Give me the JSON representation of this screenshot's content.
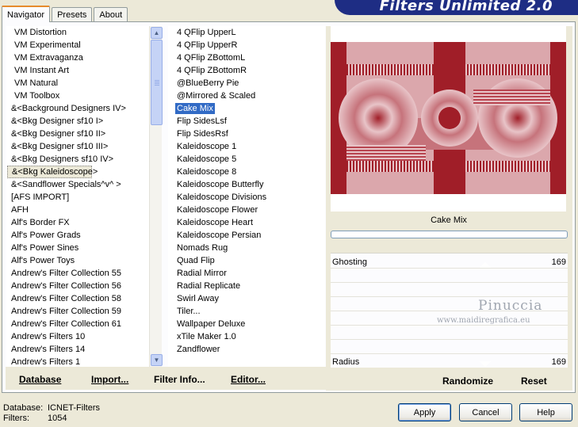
{
  "tabs": [
    "Navigator",
    "Presets",
    "About"
  ],
  "brand": "Filters Unlimited 2.0",
  "categories": [
    "VM Distortion",
    "VM Experimental",
    "VM Extravaganza",
    "VM Instant Art",
    "VM Natural",
    "VM Toolbox",
    "&<Background Designers IV>",
    "&<Bkg Designer sf10 I>",
    "&<Bkg Designer sf10 II>",
    "&<Bkg Designer sf10 III>",
    "&<Bkg Designers sf10 IV>",
    "&<Bkg Kaleidoscope>",
    "&<Sandflower Specials^v^ >",
    "[AFS IMPORT]",
    "AFH",
    "Alf's Border FX",
    "Alf's Power Grads",
    "Alf's Power Sines",
    "Alf's Power Toys",
    "Andrew's Filter Collection 55",
    "Andrew's Filter Collection 56",
    "Andrew's Filter Collection 58",
    "Andrew's Filter Collection 59",
    "Andrew's Filter Collection 61",
    "Andrew's Filters 10",
    "Andrew's Filters 14",
    "Andrew's Filters 1"
  ],
  "selected_category": "&<Bkg Kaleidoscope>",
  "filters": [
    "4 QFlip UpperL",
    "4 QFlip UpperR",
    "4 QFlip ZBottomL",
    "4 QFlip ZBottomR",
    "@BlueBerry Pie",
    "@Mirrored & Scaled",
    "Cake Mix",
    "Flip SidesLsf",
    "Flip SidesRsf",
    "Kaleidoscope 1",
    "Kaleidoscope 5",
    "Kaleidoscope 8",
    "Kaleidoscope Butterfly",
    "Kaleidoscope Divisions",
    "Kaleidoscope Flower",
    "Kaleidoscope Heart",
    "Kaleidoscope Persian",
    "Nomads Rug",
    "Quad Flip",
    "Radial Mirror",
    "Radial Replicate",
    "Swirl Away",
    "Tiler...",
    "Wallpaper Deluxe",
    "xTile Maker 1.0",
    "Zandflower"
  ],
  "selected_filter": "Cake Mix",
  "toolbar": {
    "database_label": "Database",
    "import_label": "Import...",
    "filter_info_label": "Filter Info...",
    "editor_label": "Editor..."
  },
  "preview": {
    "filter_name": "Cake Mix",
    "colors": {
      "dark": "#a01e28",
      "light": "#e8c4c8",
      "mid": "#c6737b"
    }
  },
  "params": [
    {
      "label": "Ghosting",
      "value": "169"
    },
    {
      "label": "Radius",
      "value": "169"
    }
  ],
  "watermark": {
    "name": "Pinuccia",
    "site": "www.maidiregrafica.eu"
  },
  "right_buttons": {
    "randomize": "Randomize",
    "reset": "Reset"
  },
  "status": {
    "database_key": "Database:",
    "database_value": "ICNET-Filters",
    "filters_key": "Filters:",
    "filters_value": "1054"
  },
  "buttons": {
    "apply": "Apply",
    "cancel": "Cancel",
    "help": "Help"
  }
}
